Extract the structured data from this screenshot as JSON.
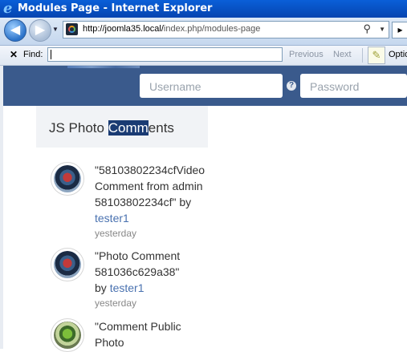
{
  "window": {
    "title": "Modules Page - Internet Explorer"
  },
  "address_bar": {
    "host": "http://joomla35.local/",
    "path": "index.php/modules-page"
  },
  "find_bar": {
    "close": "✕",
    "label": "Find:",
    "value": "",
    "previous": "Previous",
    "next": "Next",
    "options": "Optio"
  },
  "topnav": {
    "username_placeholder": "Username",
    "password_placeholder": "Password",
    "help": "?"
  },
  "module": {
    "title_pre": "JS Photo ",
    "title_hl": "Comm",
    "title_post": "ents",
    "comments": [
      {
        "lines": [
          "\"58103802234cfVideo",
          "Comment from admin",
          "58103802234cf\" by"
        ],
        "author": "tester1",
        "author_prefix": "",
        "when": "yesterday"
      },
      {
        "lines": [
          "\"Photo Comment",
          "581036c629a38\""
        ],
        "author": "tester1",
        "author_prefix": "by ",
        "when": "yesterday"
      },
      {
        "lines": [
          "\"Comment Public",
          "Photo"
        ],
        "author": "",
        "author_prefix": "",
        "when": ""
      }
    ]
  }
}
